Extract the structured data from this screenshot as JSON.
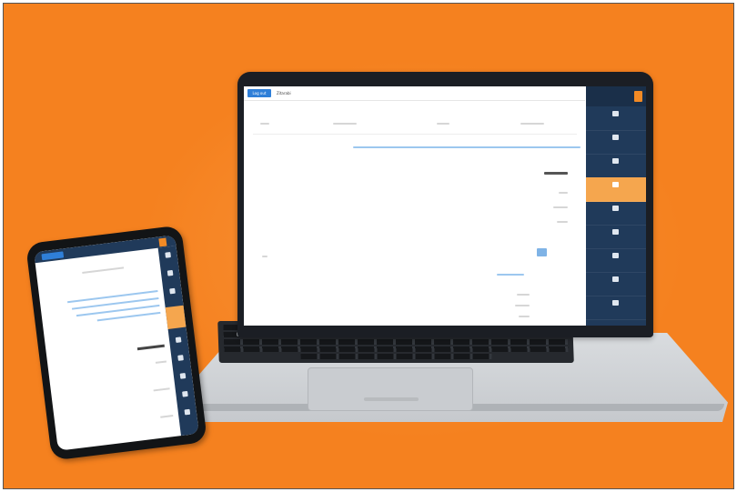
{
  "background_color": "#f5811f",
  "laptop": {
    "screen": {
      "top_button_label": "Log out",
      "top_title": "Zitarabi",
      "tabs": [
        "",
        "",
        "",
        ""
      ],
      "heading": "",
      "sidebar": {
        "header_text": "",
        "active_index": 3,
        "items": [
          "",
          "",
          "",
          "",
          "",
          "",
          "",
          "",
          "",
          ""
        ]
      }
    }
  },
  "phone": {
    "screen": {
      "heading": ""
    }
  },
  "colors": {
    "sidebar": "#203a5a",
    "accent_orange": "#f5a64e",
    "button_blue": "#2f7fd8"
  }
}
